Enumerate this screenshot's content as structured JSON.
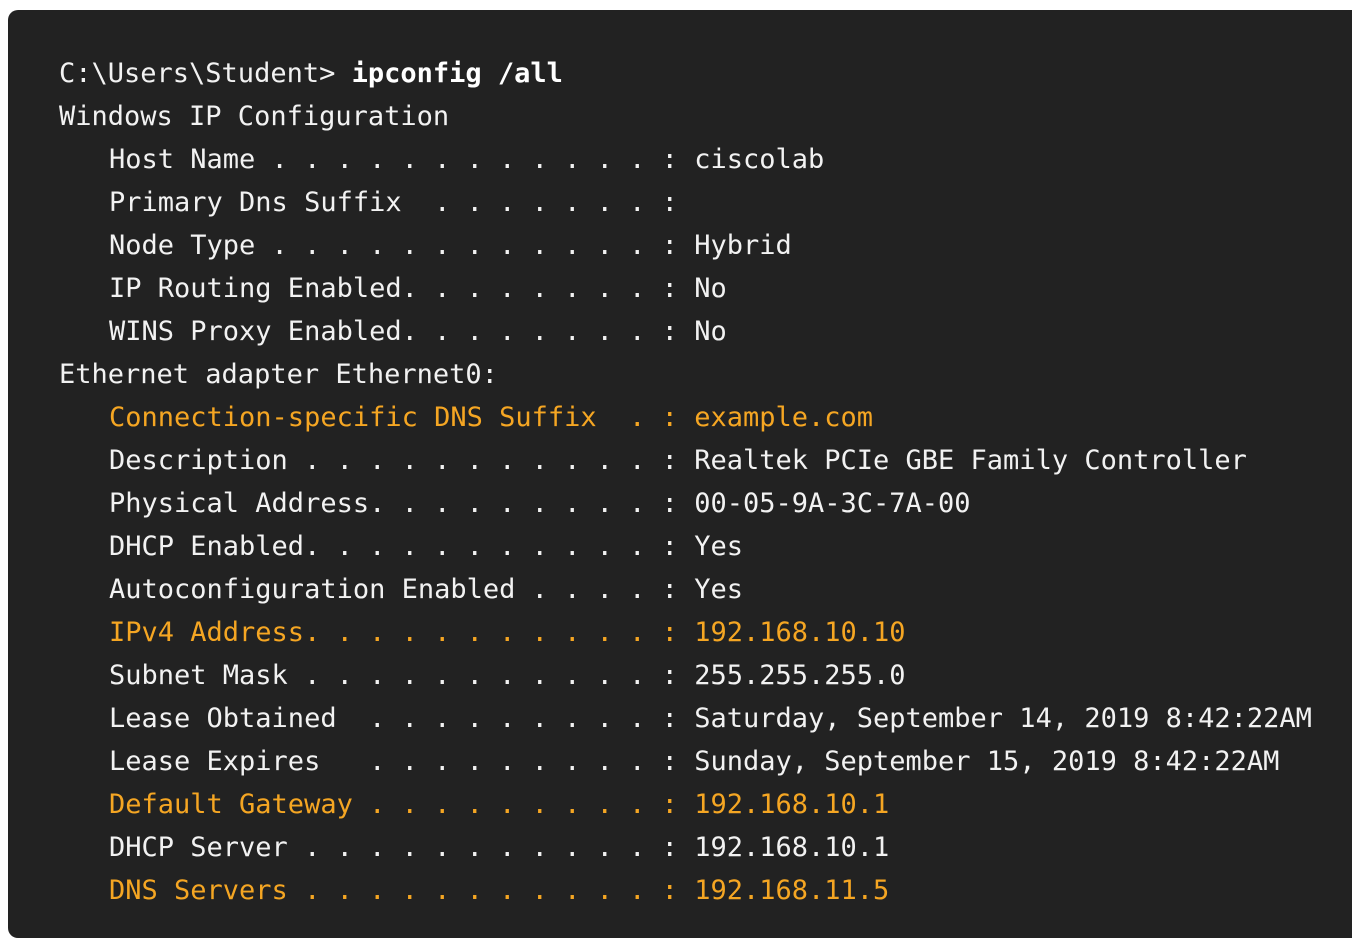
{
  "terminal": {
    "prompt": "C:\\Users\\Student> ",
    "command": "ipconfig /all",
    "header": "Windows IP Configuration",
    "adapter_header": "Ethernet adapter Ethernet0:",
    "global_config": [
      {
        "label": "Host Name . . . . . . . . . . . . : ",
        "value": "ciscolab",
        "highlight": false
      },
      {
        "label": "Primary Dns Suffix  . . . . . . . : ",
        "value": "",
        "highlight": false
      },
      {
        "label": "Node Type . . . . . . . . . . . . : ",
        "value": "Hybrid",
        "highlight": false
      },
      {
        "label": "IP Routing Enabled. . . . . . . . : ",
        "value": "No",
        "highlight": false
      },
      {
        "label": "WINS Proxy Enabled. . . . . . . . : ",
        "value": "No",
        "highlight": false
      }
    ],
    "adapter_config": [
      {
        "label": "Connection-specific DNS Suffix  . : ",
        "value": "example.com",
        "highlight": true
      },
      {
        "label": "Description . . . . . . . . . . . : ",
        "value": "Realtek PCIe GBE Family Controller",
        "highlight": false
      },
      {
        "label": "Physical Address. . . . . . . . . : ",
        "value": "00-05-9A-3C-7A-00",
        "highlight": false
      },
      {
        "label": "DHCP Enabled. . . . . . . . . . . : ",
        "value": "Yes",
        "highlight": false
      },
      {
        "label": "Autoconfiguration Enabled . . . . : ",
        "value": "Yes",
        "highlight": false
      },
      {
        "label": "IPv4 Address. . . . . . . . . . . : ",
        "value": "192.168.10.10",
        "highlight": true
      },
      {
        "label": "Subnet Mask . . . . . . . . . . . : ",
        "value": "255.255.255.0",
        "highlight": false
      },
      {
        "label": "Lease Obtained  . . . . . . . . . : ",
        "value": "Saturday, September 14, 2019 8:42:22AM",
        "highlight": false
      },
      {
        "label": "Lease Expires   . . . . . . . . . : ",
        "value": "Sunday, September 15, 2019 8:42:22AM",
        "highlight": false
      },
      {
        "label": "Default Gateway . . . . . . . . . : ",
        "value": "192.168.10.1",
        "highlight": true
      },
      {
        "label": "DHCP Server . . . . . . . . . . . : ",
        "value": "192.168.10.1",
        "highlight": false
      },
      {
        "label": "DNS Servers . . . . . . . . . . . : ",
        "value": "192.168.11.5",
        "highlight": true
      }
    ]
  },
  "colors": {
    "background": "#222222",
    "text": "#f2f2f2",
    "highlight": "#f5a623"
  }
}
